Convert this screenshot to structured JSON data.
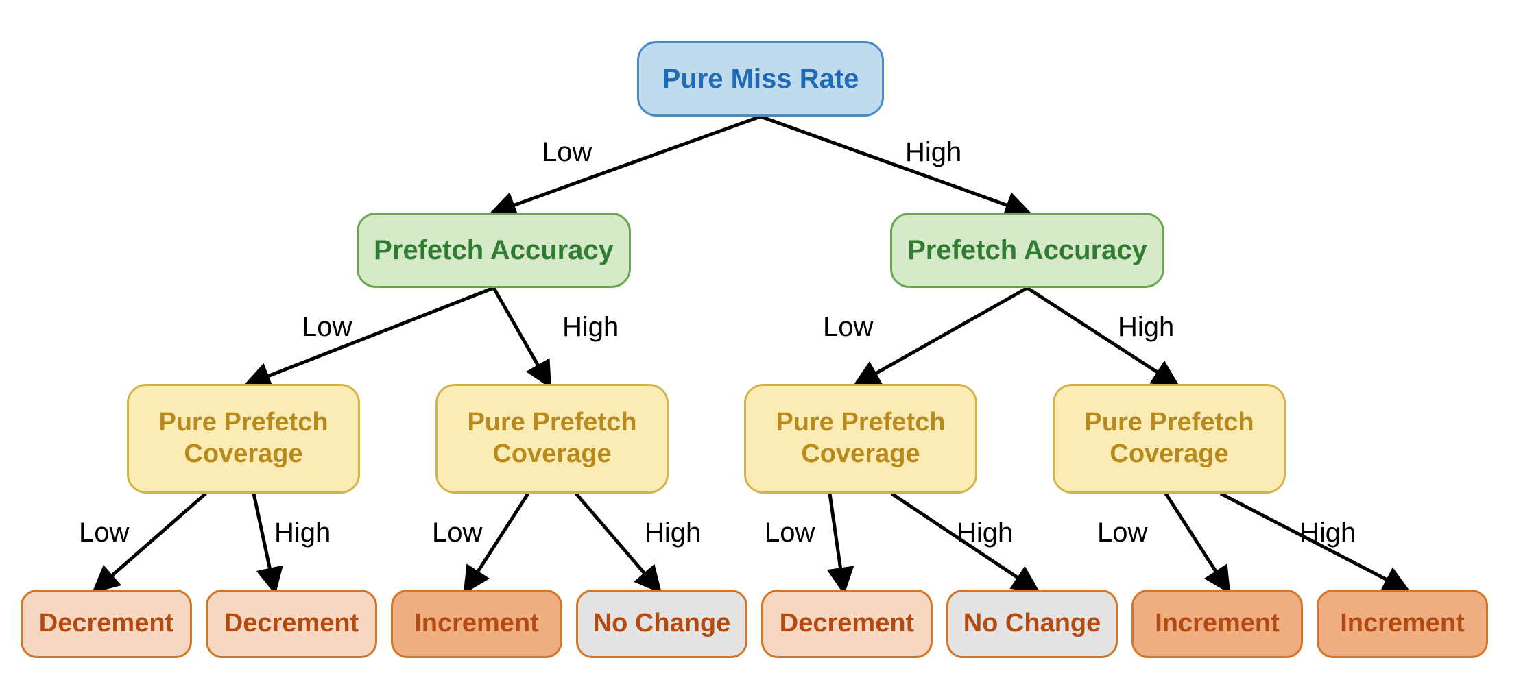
{
  "root": {
    "label": "Pure Miss Rate"
  },
  "edges_root": {
    "left": "Low",
    "right": "High"
  },
  "level2": {
    "left": {
      "label": "Prefetch Accuracy"
    },
    "right": {
      "label": "Prefetch Accuracy"
    }
  },
  "edges_l2": {
    "left": {
      "left": "Low",
      "right": "High"
    },
    "right": {
      "left": "Low",
      "right": "High"
    }
  },
  "level3": {
    "n0": {
      "label": "Pure Prefetch Coverage"
    },
    "n1": {
      "label": "Pure Prefetch Coverage"
    },
    "n2": {
      "label": "Pure Prefetch Coverage"
    },
    "n3": {
      "label": "Pure Prefetch Coverage"
    }
  },
  "edges_l3": {
    "n0": {
      "left": "Low",
      "right": "High"
    },
    "n1": {
      "left": "Low",
      "right": "High"
    },
    "n2": {
      "left": "Low",
      "right": "High"
    },
    "n3": {
      "left": "Low",
      "right": "High"
    }
  },
  "leaves": {
    "l0": {
      "label": "Decrement",
      "tone": "light"
    },
    "l1": {
      "label": "Decrement",
      "tone": "light"
    },
    "l2": {
      "label": "Increment",
      "tone": "dark"
    },
    "l3": {
      "label": "No Change",
      "tone": "grey"
    },
    "l4": {
      "label": "Decrement",
      "tone": "light"
    },
    "l5": {
      "label": "No Change",
      "tone": "grey"
    },
    "l6": {
      "label": "Increment",
      "tone": "dark"
    },
    "l7": {
      "label": "Increment",
      "tone": "dark"
    }
  }
}
